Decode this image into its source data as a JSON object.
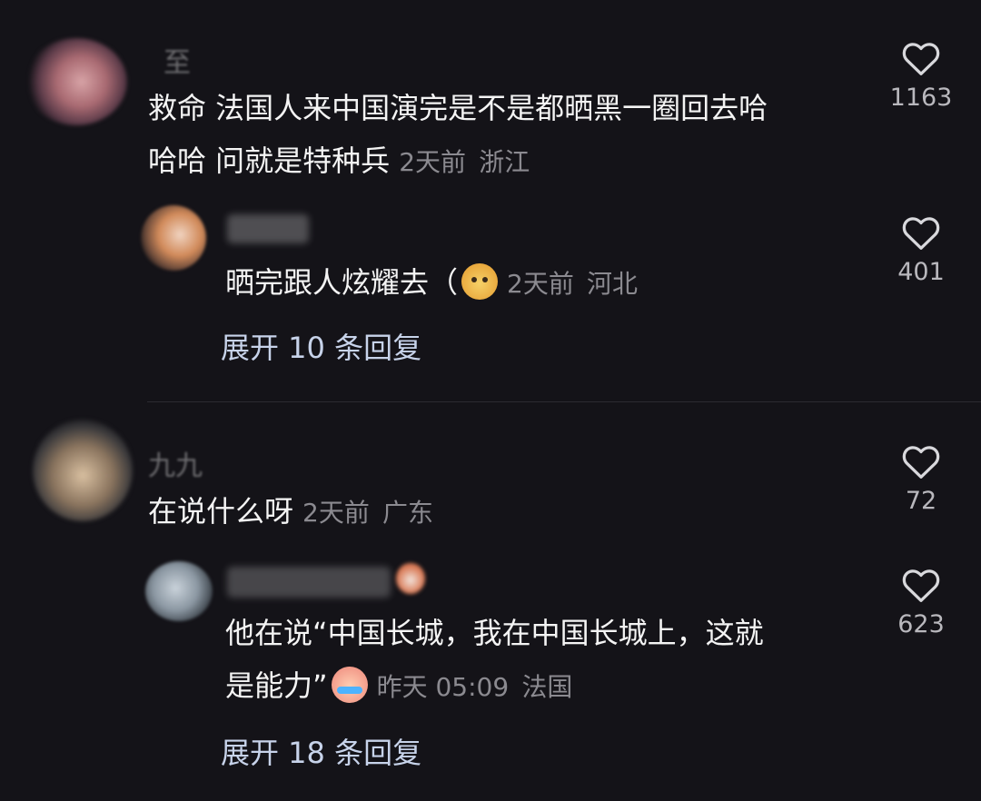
{
  "comments": [
    {
      "username": "至",
      "text_line1": "救命 法国人来中国演完是不是都晒黑一圈回去哈",
      "text_line2": "哈哈 问就是特种兵",
      "time": "2天前",
      "location": "浙江",
      "likes": "1163",
      "reply": {
        "username": "",
        "text": "晒完跟人炫耀去（",
        "emoji": "dog-face-emoji",
        "time": "2天前",
        "location": "河北",
        "likes": "401"
      },
      "expand_label": "展开 10 条回复"
    },
    {
      "username": "九九",
      "text_line1": "在说什么呀",
      "time": "2天前",
      "location": "广东",
      "likes": "72",
      "reply": {
        "username": "",
        "text_line1": "他在说“中国长城，我在中国长城上，这就",
        "text_line2": "是能力”",
        "emoji": "crying-laughing-emoji",
        "time": "昨天 05:09",
        "location": "法国",
        "likes": "623"
      },
      "expand_label": "展开 18 条回复"
    }
  ],
  "icons": {
    "like": "heart-outline-icon"
  },
  "colors": {
    "background": "#141318",
    "meta": "#8b8a90",
    "expand": "#c7d3ea"
  }
}
